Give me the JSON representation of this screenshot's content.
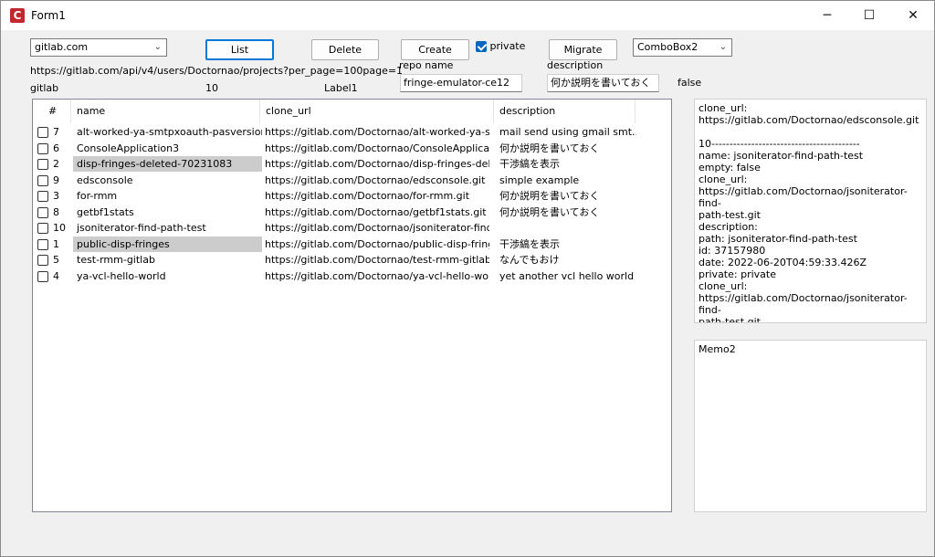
{
  "window": {
    "title": "Form1",
    "app_icon_letter": "C",
    "minimize_glyph": "─",
    "maximize_glyph": "☐",
    "close_glyph": "✕"
  },
  "toolbar": {
    "host_combo": "gitlab.com",
    "list_label": "List",
    "delete_label": "Delete",
    "create_label": "Create",
    "private_label": "private",
    "private_checked": true,
    "migrate_label": "Migrate",
    "combo2": "ComboBox2",
    "repo_name_label": "repo name",
    "repo_name_value": "fringe-emulator-ce12",
    "description_label": "description",
    "description_value": "何か説明を書いておく",
    "false_label": "false"
  },
  "info": {
    "api_url": "https://gitlab.com/api/v4/users/Doctornao/projects?per_page=100page=1",
    "source": "gitlab",
    "count": "10",
    "label1": "Label1"
  },
  "table": {
    "columns": [
      "#",
      "name",
      "clone_url",
      "description"
    ],
    "rows": [
      {
        "num": "7",
        "name": "alt-worked-ya-smtpxoauth-pasversion",
        "url": "https://gitlab.com/Doctornao/alt-worked-ya-s...",
        "desc": "mail send using gmail smt...",
        "selected": false
      },
      {
        "num": "6",
        "name": "ConsoleApplication3",
        "url": "https://gitlab.com/Doctornao/ConsoleApplicati...",
        "desc": "何か説明を書いておく",
        "selected": false
      },
      {
        "num": "2",
        "name": "disp-fringes-deleted-70231083",
        "url": "https://gitlab.com/Doctornao/disp-fringes-dele...",
        "desc": "干渉縞を表示",
        "selected": true
      },
      {
        "num": "9",
        "name": "edsconsole",
        "url": "https://gitlab.com/Doctornao/edsconsole.git",
        "desc": "simple example",
        "selected": false
      },
      {
        "num": "3",
        "name": "for-rmm",
        "url": "https://gitlab.com/Doctornao/for-rmm.git",
        "desc": "何か説明を書いておく",
        "selected": false
      },
      {
        "num": "8",
        "name": "getbf1stats",
        "url": "https://gitlab.com/Doctornao/getbf1stats.git",
        "desc": "何か説明を書いておく",
        "selected": false
      },
      {
        "num": "10",
        "name": "jsoniterator-find-path-test",
        "url": "https://gitlab.com/Doctornao/jsoniterator-find...",
        "desc": "",
        "selected": false
      },
      {
        "num": "1",
        "name": "public-disp-fringes",
        "url": "https://gitlab.com/Doctornao/public-disp-fring...",
        "desc": "干渉縞を表示",
        "selected": true
      },
      {
        "num": "5",
        "name": "test-rmm-gitlab",
        "url": "https://gitlab.com/Doctornao/test-rmm-gitlab.git",
        "desc": "なんでもおけ",
        "selected": false
      },
      {
        "num": "4",
        "name": "ya-vcl-hello-world",
        "url": "https://gitlab.com/Doctornao/ya-vcl-hello-worl...",
        "desc": "yet another vcl hello world",
        "selected": false
      }
    ]
  },
  "memo1": "clone_url:\nhttps://gitlab.com/Doctornao/edsconsole.git\n\n10-----------------------------------------\nname: jsoniterator-find-path-test\nempty: false\nclone_url:\nhttps://gitlab.com/Doctornao/jsoniterator-find-\npath-test.git\ndescription:\npath: jsoniterator-find-path-test\nid: 37157980\ndate: 2022-06-20T04:59:33.426Z\nprivate: private\nclone_url:\nhttps://gitlab.com/Doctornao/jsoniterator-find-\npath-test.git",
  "memo2": "Memo2"
}
